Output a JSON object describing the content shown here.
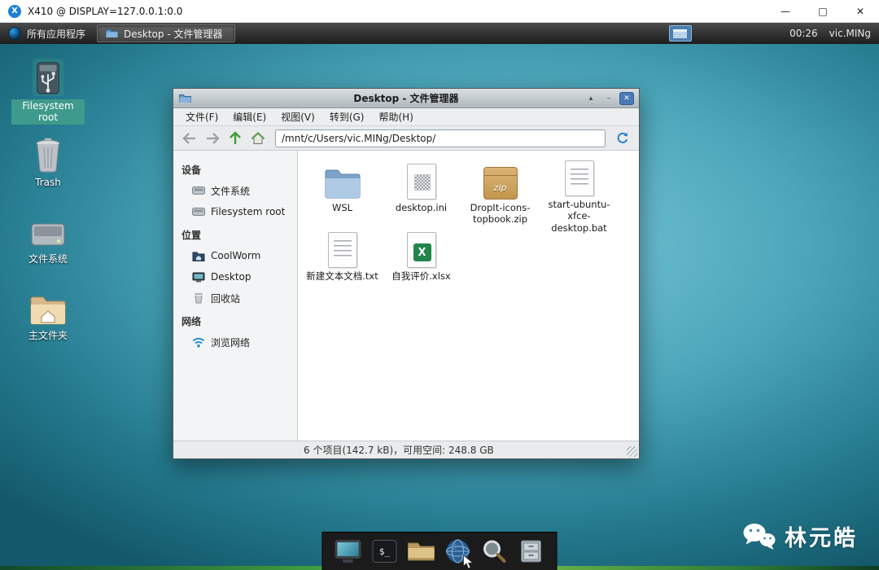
{
  "host_window": {
    "title": "X410 @ DISPLAY=127.0.0.1:0.0",
    "controls": {
      "minimize": "—",
      "maximize": "□",
      "close": "✕"
    }
  },
  "panel": {
    "applications_label": "所有应用程序",
    "taskbar_item_label": "Desktop - 文件管理器",
    "clock": "00:26",
    "username": "vic.MINg"
  },
  "desktop_icons": [
    {
      "label": "Filesystem root"
    },
    {
      "label": "Trash"
    },
    {
      "label": "文件系统"
    },
    {
      "label": "主文件夹"
    }
  ],
  "file_manager": {
    "title": "Desktop - 文件管理器",
    "controls": {
      "shade": "▴",
      "minimize": "–",
      "close": "✕"
    },
    "menu_items": [
      "文件(F)",
      "编辑(E)",
      "视图(V)",
      "转到(G)",
      "帮助(H)"
    ],
    "address": "/mnt/c/Users/vic.MINg/Desktop/",
    "sidebar": {
      "devices_header": "设备",
      "devices": [
        "文件系统",
        "Filesystem root"
      ],
      "places_header": "位置",
      "places": [
        "CoolWorm",
        "Desktop",
        "回收站"
      ],
      "network_header": "网络",
      "network": [
        "浏览网络"
      ]
    },
    "files": [
      {
        "name": "WSL"
      },
      {
        "name": "desktop.ini"
      },
      {
        "name": "DropIt-icons-topbook.zip"
      },
      {
        "name": "start-ubuntu-xfce-desktop.bat"
      },
      {
        "name": "新建文本文档.txt"
      },
      {
        "name": "自我评价.xlsx"
      }
    ],
    "status_text": "6 个项目(142.7 kB)，可用空间: 248.8 GB"
  },
  "icon_glyphs": {
    "x410_logo": "X",
    "zip_badge": "zip",
    "terminal_prompt": "$_",
    "excel_letter": "X"
  },
  "watermark": {
    "name": "林元皓"
  },
  "colors": {
    "desktop_teal": "#49a2b5",
    "selection_teal": "#3e9a8c",
    "close_blue": "#4a7ab5",
    "panel_dark": "#1d1d1d"
  }
}
